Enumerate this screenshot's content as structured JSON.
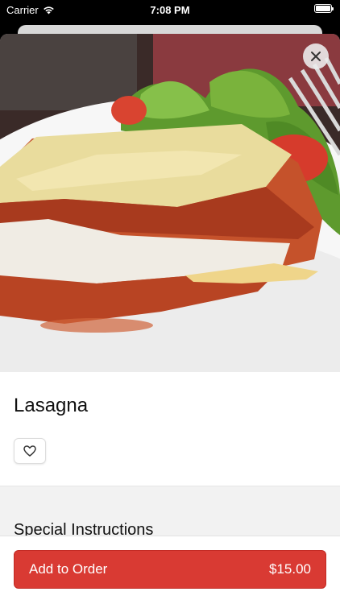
{
  "status_bar": {
    "carrier": "Carrier",
    "time": "7:08 PM",
    "wifi_icon": "wifi-icon",
    "battery_icon": "battery-icon"
  },
  "item": {
    "name": "Lasagna",
    "image": "lasagna-photo",
    "favorite_icon": "heart-outline-icon",
    "close_icon": "close-icon"
  },
  "special_instructions": {
    "heading": "Special Instructions"
  },
  "order_button": {
    "label": "Add to Order",
    "price": "$15.00"
  },
  "colors": {
    "accent": "#d93a33"
  }
}
